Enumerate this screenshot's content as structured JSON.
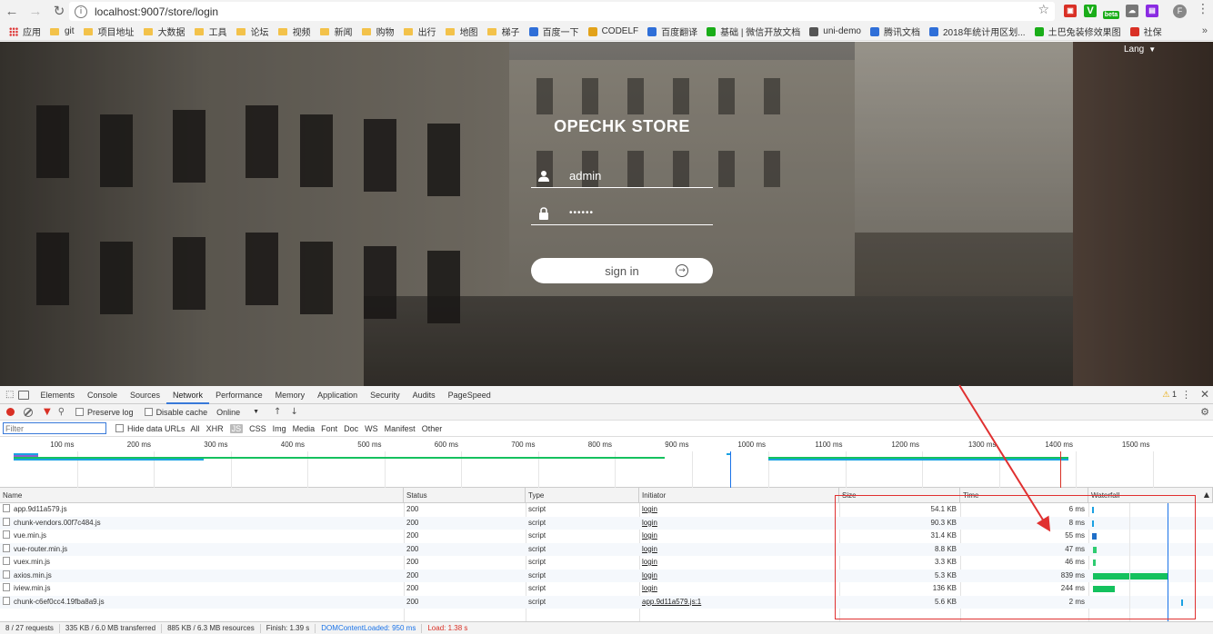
{
  "browser": {
    "url": "localhost:9007/store/login",
    "bookmarks": [
      {
        "label": "应用",
        "kind": "apps"
      },
      {
        "label": "git",
        "kind": "folder"
      },
      {
        "label": "项目地址",
        "kind": "folder"
      },
      {
        "label": "大数据",
        "kind": "folder"
      },
      {
        "label": "工具",
        "kind": "folder"
      },
      {
        "label": "论坛",
        "kind": "folder"
      },
      {
        "label": "视频",
        "kind": "folder"
      },
      {
        "label": "新闻",
        "kind": "folder"
      },
      {
        "label": "购物",
        "kind": "folder"
      },
      {
        "label": "出行",
        "kind": "folder"
      },
      {
        "label": "地图",
        "kind": "folder"
      },
      {
        "label": "梯子",
        "kind": "folder"
      },
      {
        "label": "百度一下",
        "kind": "site",
        "color": "#2f6fd8"
      },
      {
        "label": "CODELF",
        "kind": "site",
        "color": "#e2a21a"
      },
      {
        "label": "百度翻译",
        "kind": "site",
        "color": "#2f6fd8"
      },
      {
        "label": "基础 | 微信开放文档",
        "kind": "site",
        "color": "#1aad19"
      },
      {
        "label": "uni-demo",
        "kind": "site",
        "color": "#555555"
      },
      {
        "label": "腾讯文档",
        "kind": "site",
        "color": "#2f6fd8"
      },
      {
        "label": "2018年统计用区划...",
        "kind": "site",
        "color": "#2f6fd8"
      },
      {
        "label": "土巴兔装修效果图",
        "kind": "site",
        "color": "#1aad19"
      },
      {
        "label": "社保",
        "kind": "site",
        "color": "#d93025"
      }
    ],
    "more": "»",
    "ext_beta": "beta"
  },
  "login": {
    "lang": "Lang",
    "title": "OPECHK STORE",
    "username": "admin",
    "password": "••••••",
    "signin": "sign in"
  },
  "devtools": {
    "tabs": [
      "Elements",
      "Console",
      "Sources",
      "Network",
      "Performance",
      "Memory",
      "Application",
      "Security",
      "Audits",
      "PageSpeed"
    ],
    "active_tab": "Network",
    "warnings": "1",
    "toolbar": {
      "preserve_log": "Preserve log",
      "disable_cache": "Disable cache",
      "throttle": "Online"
    },
    "filter": {
      "placeholder": "Filter",
      "hide_data_urls": "Hide data URLs",
      "types": [
        "All",
        "XHR",
        "JS",
        "CSS",
        "Img",
        "Media",
        "Font",
        "Doc",
        "WS",
        "Manifest",
        "Other"
      ],
      "active_type": "JS"
    },
    "timeline_ticks": [
      "100 ms",
      "200 ms",
      "300 ms",
      "400 ms",
      "500 ms",
      "600 ms",
      "700 ms",
      "800 ms",
      "900 ms",
      "1000 ms",
      "1100 ms",
      "1200 ms",
      "1300 ms",
      "1400 ms",
      "1500 ms",
      "160"
    ],
    "columns": [
      "Name",
      "Status",
      "Type",
      "Initiator",
      "Size",
      "Time",
      "Waterfall"
    ],
    "rows": [
      {
        "name": "app.9d11a579.js",
        "status": "200",
        "type": "script",
        "initiator": "login",
        "size": "54.1 KB",
        "time": "6 ms",
        "wf_start": 0.2,
        "wf_len": 0.4,
        "wf_color": "#1ba1e2"
      },
      {
        "name": "chunk-vendors.00f7c484.js",
        "status": "200",
        "type": "script",
        "initiator": "login",
        "size": "90.3 KB",
        "time": "8 ms",
        "wf_start": 0.2,
        "wf_len": 0.5,
        "wf_color": "#1ba1e2"
      },
      {
        "name": "vue.min.js",
        "status": "200",
        "type": "script",
        "initiator": "login",
        "size": "31.4 KB",
        "time": "55 ms",
        "wf_start": 0.3,
        "wf_len": 3.3,
        "wf_color": "#1f6fc8"
      },
      {
        "name": "vue-router.min.js",
        "status": "200",
        "type": "script",
        "initiator": "login",
        "size": "8.8 KB",
        "time": "47 ms",
        "wf_start": 0.4,
        "wf_len": 2.8,
        "wf_color": "#2ecc71"
      },
      {
        "name": "vuex.min.js",
        "status": "200",
        "type": "script",
        "initiator": "login",
        "size": "3.3 KB",
        "time": "46 ms",
        "wf_start": 0.4,
        "wf_len": 2.7,
        "wf_color": "#2ecc71"
      },
      {
        "name": "axios.min.js",
        "status": "200",
        "type": "script",
        "initiator": "login",
        "size": "5.3 KB",
        "time": "839 ms",
        "wf_start": 1.0,
        "wf_len": 57.0,
        "wf_color": "#14c15e"
      },
      {
        "name": "iview.min.js",
        "status": "200",
        "type": "script",
        "initiator": "login",
        "size": "136 KB",
        "time": "244 ms",
        "wf_start": 0.5,
        "wf_len": 17.0,
        "wf_color": "#14c15e"
      },
      {
        "name": "chunk-c6ef0cc4.19fba8a9.js",
        "status": "200",
        "type": "script",
        "initiator": "app.9d11a579.js:1",
        "size": "5.6 KB",
        "time": "2 ms",
        "wf_start": 68.5,
        "wf_len": 0.4,
        "wf_color": "#1ba1e2"
      }
    ],
    "status_bar": {
      "requests": "8 / 27 requests",
      "transferred": "335 KB / 6.0 MB transferred",
      "resources": "885 KB / 6.3 MB resources",
      "finish": "Finish: 1.39 s",
      "dom_loaded": "DOMContentLoaded: 950 ms",
      "load": "Load: 1.38 s"
    },
    "colors": {
      "dom_loaded": "#1a73e8",
      "load": "#d93025",
      "annotation": "#e03030"
    }
  }
}
